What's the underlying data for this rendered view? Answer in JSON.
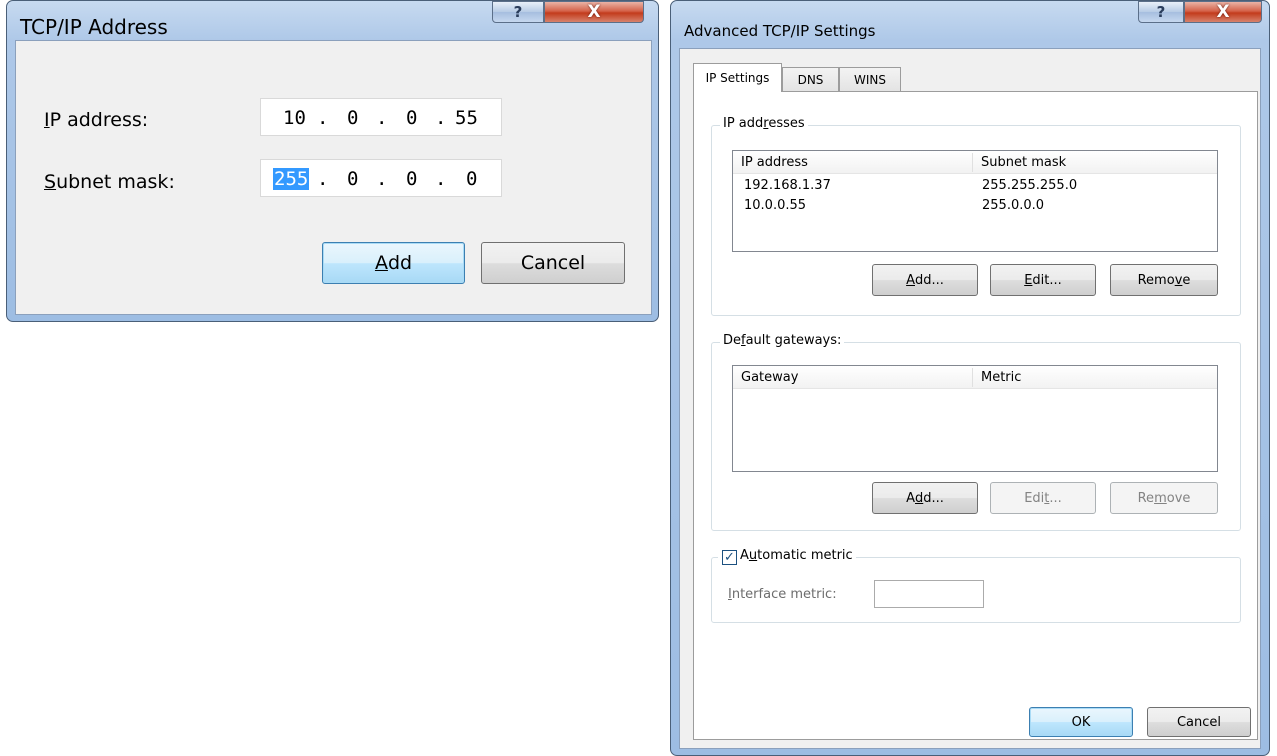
{
  "small_dialog": {
    "title": "TCP/IP Address",
    "help_glyph": "?",
    "close_glyph": "X",
    "ip_label": {
      "pre": "",
      "accel": "I",
      "post": "P address:"
    },
    "ip_octets": [
      "10",
      "0",
      "0",
      "55"
    ],
    "mask_label": {
      "pre": "",
      "accel": "S",
      "post": "ubnet mask:"
    },
    "mask_octets": [
      "255",
      "0",
      "0",
      "0"
    ],
    "dot": ".",
    "add_button": {
      "pre": "",
      "accel": "A",
      "post": "dd"
    },
    "cancel_button": "Cancel"
  },
  "advanced_dialog": {
    "title": "Advanced TCP/IP Settings",
    "help_glyph": "?",
    "close_glyph": "X",
    "tabs": [
      "IP Settings",
      "DNS",
      "WINS"
    ],
    "ip_group": {
      "label": {
        "pre": "IP add",
        "accel": "r",
        "post": "esses"
      },
      "columns": [
        "IP address",
        "Subnet mask"
      ],
      "rows": [
        {
          "ip": "192.168.1.37",
          "mask": "255.255.255.0"
        },
        {
          "ip": "10.0.0.55",
          "mask": "255.0.0.0"
        }
      ],
      "add": {
        "pre": "",
        "accel": "A",
        "post": "dd..."
      },
      "edit": {
        "pre": "",
        "accel": "E",
        "post": "dit..."
      },
      "remove": {
        "pre": "Remo",
        "accel": "v",
        "post": "e"
      }
    },
    "gw_group": {
      "label": {
        "pre": "De",
        "accel": "f",
        "post": "ault gateways:"
      },
      "columns": [
        "Gateway",
        "Metric"
      ],
      "add": {
        "pre": "A",
        "accel": "d",
        "post": "d..."
      },
      "edit": {
        "pre": "Edi",
        "accel": "t",
        "post": "..."
      },
      "remove": {
        "pre": "Re",
        "accel": "m",
        "post": "ove"
      }
    },
    "metric_group": {
      "checkbox_checked": true,
      "check_glyph": "✓",
      "label": {
        "pre": "A",
        "accel": "u",
        "post": "tomatic metric"
      },
      "interface_label": {
        "pre": "",
        "accel": "I",
        "post": "nterface metric:"
      },
      "interface_value": ""
    },
    "ok_button": "OK",
    "cancel_button": "Cancel"
  }
}
